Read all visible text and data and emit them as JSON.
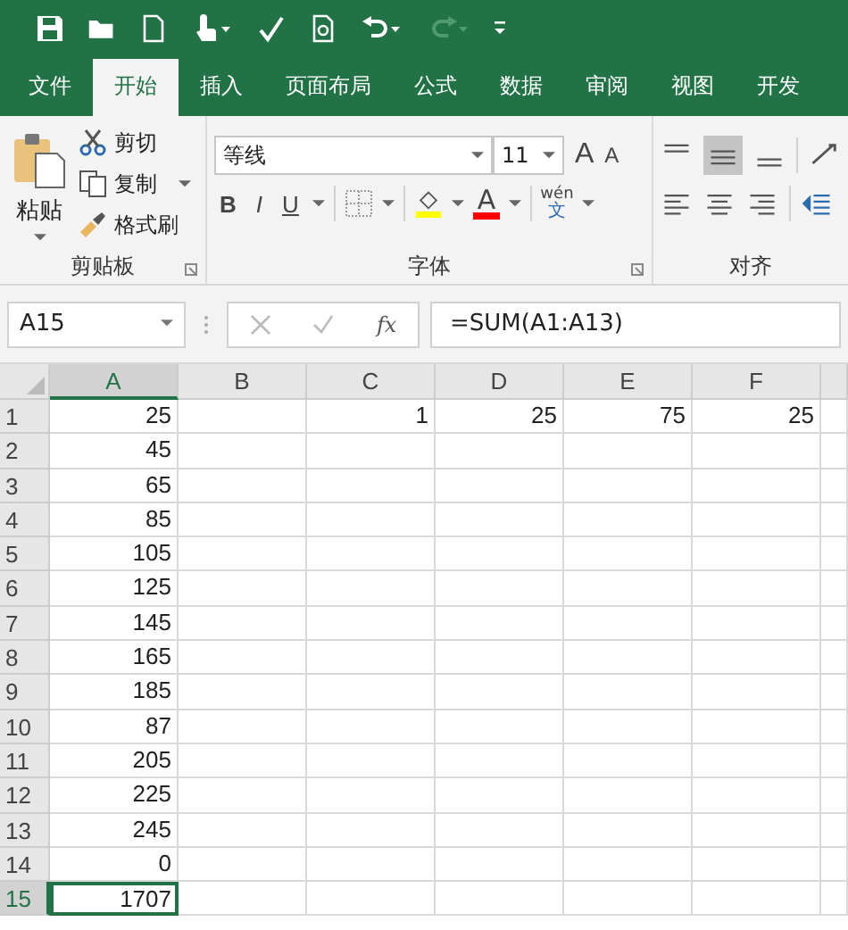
{
  "tabs": [
    {
      "label": "文件",
      "selected": false
    },
    {
      "label": "开始",
      "selected": true
    },
    {
      "label": "插入",
      "selected": false
    },
    {
      "label": "页面布局",
      "selected": false
    },
    {
      "label": "公式",
      "selected": false
    },
    {
      "label": "数据",
      "selected": false
    },
    {
      "label": "审阅",
      "selected": false
    },
    {
      "label": "视图",
      "selected": false
    },
    {
      "label": "开发",
      "selected": false
    }
  ],
  "redo": {
    "disabled": true
  },
  "clipboard": {
    "paste": "粘贴",
    "cut": "剪切",
    "copy": "复制",
    "format_painter": "格式刷",
    "group_label": "剪贴板"
  },
  "font": {
    "font_name": "等线",
    "font_size": "11",
    "grow": "A",
    "shrink": "A",
    "bold": "B",
    "italic": "I",
    "underline": "U",
    "font_color": "A",
    "phonetic_top": "wén",
    "phonetic_bottom": "文",
    "group_label": "字体"
  },
  "alignment": {
    "group_label": "对齐",
    "middle_align": {
      "selected": true
    }
  },
  "formula_bar": {
    "name_box": "A15",
    "fx": "fx",
    "formula": "=SUM(A1:A13)"
  },
  "columns": [
    {
      "label": "A",
      "selected": true
    },
    {
      "label": "B",
      "selected": false
    },
    {
      "label": "C",
      "selected": false
    },
    {
      "label": "D",
      "selected": false
    },
    {
      "label": "E",
      "selected": false
    },
    {
      "label": "F",
      "selected": false
    }
  ],
  "rows": [
    {
      "number": "1",
      "selected": false,
      "cells": [
        "25",
        "",
        "1",
        "25",
        "75",
        "25"
      ]
    },
    {
      "number": "2",
      "selected": false,
      "cells": [
        "45",
        "",
        "",
        "",
        "",
        ""
      ]
    },
    {
      "number": "3",
      "selected": false,
      "cells": [
        "65",
        "",
        "",
        "",
        "",
        ""
      ]
    },
    {
      "number": "4",
      "selected": false,
      "cells": [
        "85",
        "",
        "",
        "",
        "",
        ""
      ]
    },
    {
      "number": "5",
      "selected": false,
      "cells": [
        "105",
        "",
        "",
        "",
        "",
        ""
      ]
    },
    {
      "number": "6",
      "selected": false,
      "cells": [
        "125",
        "",
        "",
        "",
        "",
        ""
      ]
    },
    {
      "number": "7",
      "selected": false,
      "cells": [
        "145",
        "",
        "",
        "",
        "",
        ""
      ]
    },
    {
      "number": "8",
      "selected": false,
      "cells": [
        "165",
        "",
        "",
        "",
        "",
        ""
      ]
    },
    {
      "number": "9",
      "selected": false,
      "cells": [
        "185",
        "",
        "",
        "",
        "",
        ""
      ]
    },
    {
      "number": "10",
      "selected": false,
      "cells": [
        "87",
        "",
        "",
        "",
        "",
        ""
      ]
    },
    {
      "number": "11",
      "selected": false,
      "cells": [
        "205",
        "",
        "",
        "",
        "",
        ""
      ]
    },
    {
      "number": "12",
      "selected": false,
      "cells": [
        "225",
        "",
        "",
        "",
        "",
        ""
      ]
    },
    {
      "number": "13",
      "selected": false,
      "cells": [
        "245",
        "",
        "",
        "",
        "",
        ""
      ]
    },
    {
      "number": "14",
      "selected": false,
      "cells": [
        "0",
        "",
        "",
        "",
        "",
        ""
      ]
    },
    {
      "number": "15",
      "selected": true,
      "cells": [
        "1707",
        "",
        "",
        "",
        "",
        ""
      ]
    }
  ]
}
